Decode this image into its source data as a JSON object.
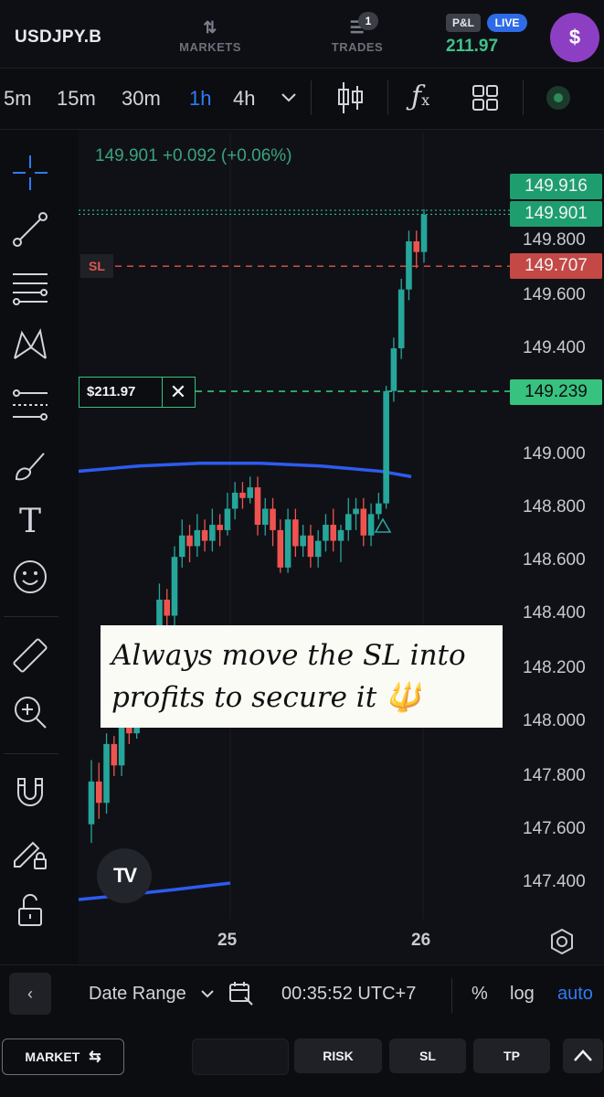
{
  "header": {
    "symbol": "USDJPY.B",
    "markets_label": "MARKETS",
    "trades_label": "TRADES",
    "trades_badge": "1",
    "pl_label": "P&L",
    "live_label": "LIVE",
    "pl_value": "211.97",
    "avatar_symbol": "$"
  },
  "timeframes": [
    "5m",
    "15m",
    "30m",
    "1h",
    "4h"
  ],
  "active_timeframe": "1h",
  "toolbar_icons": [
    "crosshair-icon",
    "trend-line-icon",
    "fib-lines-icon",
    "pattern-icon",
    "channel-icon",
    "brush-icon",
    "text-icon",
    "emoji-icon",
    "ruler-icon",
    "zoom-in-icon",
    "magnet-icon",
    "lock-drawing-icon",
    "unlock-icon"
  ],
  "chart": {
    "ohlc_readout": "149.901  +0.092 (+0.06%)",
    "price_labels": [
      "149.800",
      "149.600",
      "149.400",
      "149.000",
      "148.800",
      "148.600",
      "148.400",
      "148.200",
      "148.000",
      "147.800",
      "147.600",
      "147.400"
    ],
    "tags": {
      "high": "149.916",
      "current": "149.901",
      "sl": "149.707",
      "entry": "149.239"
    },
    "sl_tag": "SL",
    "position_value": "$211.97",
    "date_labels": [
      "25",
      "26"
    ],
    "note": "Always move the SL into profits to secure it 🔱",
    "logo": "TV",
    "colors": {
      "up": "#26a69a",
      "down": "#ef5350",
      "sl": "#e0574f",
      "entry": "#37c27f",
      "ma": "#2e5bf0"
    }
  },
  "chart_data": {
    "type": "candlestick",
    "instrument": "USDJPY.B",
    "timeframe": "1h",
    "x_ticks": [
      "25",
      "26"
    ],
    "y_ticks": [
      147.4,
      147.6,
      147.8,
      148.0,
      148.2,
      148.4,
      148.6,
      148.8,
      149.0,
      149.2,
      149.4,
      149.6,
      149.8
    ],
    "levels": {
      "high": 149.916,
      "last": 149.901,
      "stop_loss": 149.707,
      "entry": 149.239
    },
    "candles": [
      [
        147.62,
        147.78,
        147.55,
        147.86
      ],
      [
        147.78,
        147.7,
        147.64,
        147.85
      ],
      [
        147.7,
        147.92,
        147.66,
        147.96
      ],
      [
        147.92,
        147.84,
        147.8,
        147.95
      ],
      [
        147.84,
        148.02,
        147.8,
        148.06
      ],
      [
        148.02,
        147.96,
        147.92,
        148.08
      ],
      [
        147.96,
        148.16,
        147.94,
        148.2
      ],
      [
        148.16,
        148.12,
        148.06,
        148.22
      ],
      [
        148.12,
        148.32,
        148.08,
        148.36
      ],
      [
        148.32,
        148.46,
        148.28,
        148.52
      ],
      [
        148.46,
        148.4,
        148.34,
        148.5
      ],
      [
        148.4,
        148.62,
        148.36,
        148.66
      ],
      [
        148.62,
        148.7,
        148.58,
        148.76
      ],
      [
        148.7,
        148.66,
        148.6,
        148.74
      ],
      [
        148.66,
        148.72,
        148.62,
        148.78
      ],
      [
        148.72,
        148.68,
        148.64,
        148.76
      ],
      [
        148.68,
        148.74,
        148.64,
        148.8
      ],
      [
        148.74,
        148.72,
        148.66,
        148.78
      ],
      [
        148.72,
        148.8,
        148.7,
        148.86
      ],
      [
        148.8,
        148.86,
        148.76,
        148.9
      ],
      [
        148.86,
        148.84,
        148.8,
        148.9
      ],
      [
        148.84,
        148.88,
        148.82,
        148.92
      ],
      [
        148.88,
        148.74,
        148.7,
        148.92
      ],
      [
        148.74,
        148.8,
        148.7,
        148.84
      ],
      [
        148.8,
        148.72,
        148.66,
        148.84
      ],
      [
        148.72,
        148.58,
        148.56,
        148.76
      ],
      [
        148.58,
        148.76,
        148.56,
        148.8
      ],
      [
        148.76,
        148.66,
        148.62,
        148.8
      ],
      [
        148.66,
        148.7,
        148.62,
        148.74
      ],
      [
        148.7,
        148.62,
        148.58,
        148.74
      ],
      [
        148.62,
        148.68,
        148.58,
        148.72
      ],
      [
        148.68,
        148.74,
        148.64,
        148.78
      ],
      [
        148.74,
        148.68,
        148.64,
        148.8
      ],
      [
        148.68,
        148.72,
        148.6,
        148.74
      ],
      [
        148.72,
        148.78,
        148.68,
        148.84
      ],
      [
        148.78,
        148.8,
        148.72,
        148.84
      ],
      [
        148.8,
        148.7,
        148.66,
        148.84
      ],
      [
        148.7,
        148.78,
        148.66,
        148.82
      ],
      [
        148.78,
        148.82,
        148.76,
        148.86
      ],
      [
        148.82,
        149.24,
        148.8,
        149.26
      ],
      [
        149.24,
        149.4,
        149.2,
        149.44
      ],
      [
        149.4,
        149.62,
        149.36,
        149.66
      ],
      [
        149.62,
        149.8,
        149.58,
        149.84
      ],
      [
        149.8,
        149.76,
        149.7,
        149.84
      ],
      [
        149.76,
        149.9,
        149.72,
        149.92
      ]
    ],
    "moving_average": [
      {
        "x": 0,
        "y": 148.94
      },
      {
        "x": 8,
        "y": 148.96
      },
      {
        "x": 16,
        "y": 148.97
      },
      {
        "x": 24,
        "y": 148.97
      },
      {
        "x": 32,
        "y": 148.96
      },
      {
        "x": 40,
        "y": 148.94
      },
      {
        "x": 44,
        "y": 148.92
      }
    ]
  },
  "datebar": {
    "back": "‹",
    "date_range": "Date Range",
    "time": "00:35:52 UTC+7",
    "percent": "%",
    "log": "log",
    "auto": "auto"
  },
  "actions": {
    "market": "MARKET",
    "risk": "RISK",
    "sl": "SL",
    "tp": "TP"
  }
}
